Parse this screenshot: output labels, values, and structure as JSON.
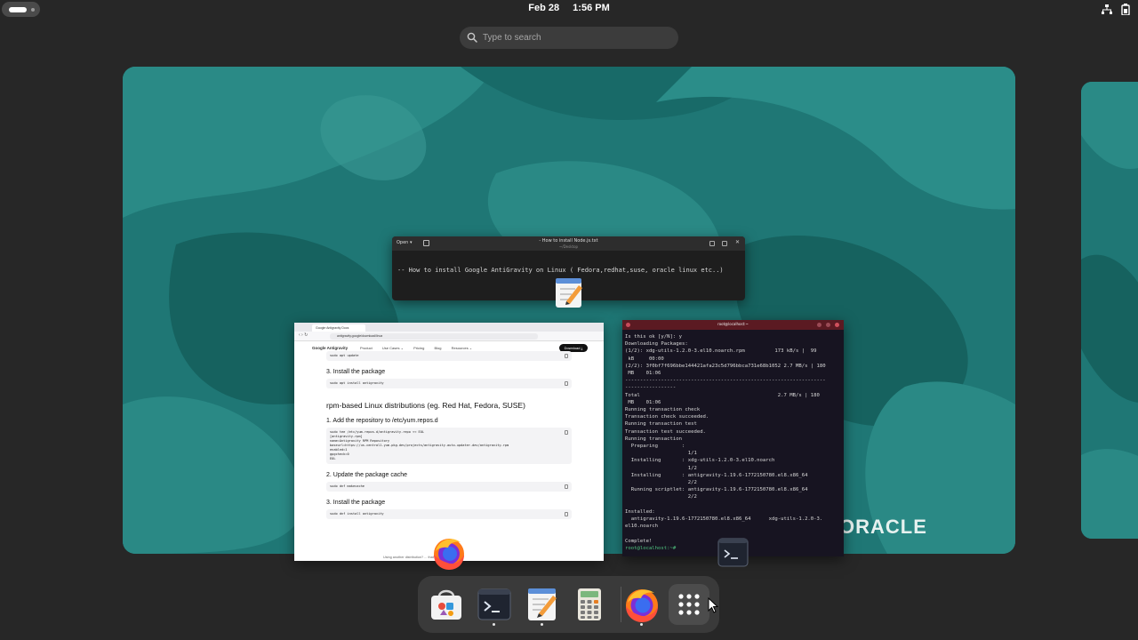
{
  "topbar": {
    "date": "Feb 28",
    "time": "1:56 PM",
    "activities_icon": "activities-indicator",
    "tray_icons": [
      "network-wired-icon",
      "battery-icon"
    ]
  },
  "search": {
    "placeholder": "Type to search"
  },
  "workspace": {
    "wallpaper_brand": "ORACLE"
  },
  "editor_window": {
    "open_label": "Open ▾",
    "title": "- How to install Node.js.txt",
    "subtitle": "~/Desktop",
    "content": "-- How to install Google AntiGravity on Linux ( Fedora,redhat,suse, oracle linux etc..)",
    "app_icon": "text-editor-icon"
  },
  "browser_window": {
    "tab_title": "Google Antigravity Docs",
    "url": "antigravity.google/download/linux",
    "brand": "Google Antigravity",
    "nav_items": [
      "Product",
      "Use Cases ⌄",
      "Pricing",
      "Blog",
      "Resources ⌄"
    ],
    "download_label": "Download ⤓",
    "sections": [
      {
        "kind": "code",
        "text": "sudo apt update"
      },
      {
        "kind": "h3",
        "text": "3. Install the package"
      },
      {
        "kind": "code",
        "text": "sudo apt install antigravity"
      },
      {
        "kind": "h2",
        "text": "rpm-based Linux distributions (eg. Red Hat, Fedora, SUSE)"
      },
      {
        "kind": "h3",
        "text": "1. Add the repository to /etc/yum.repos.d"
      },
      {
        "kind": "code",
        "text": "sudo tee /etc/yum.repos.d/antigravity.repo << EOL\n[antigravity-rpm]\nname=Antigravity RPM Repository\nbaseurl=https://us-central1-yum.pkg.dev/projects/antigravity-auto-updater-dev/antigravity-rpm\nenabled=1\ngpgcheck=0\nEOL"
      },
      {
        "kind": "h3",
        "text": "2. Update the package cache"
      },
      {
        "kind": "code",
        "text": "sudo dnf makecache"
      },
      {
        "kind": "h3",
        "text": "3. Install the package"
      },
      {
        "kind": "code",
        "text": "sudo dnf install antigravity"
      }
    ],
    "footnote": "Using another distribution? ... that source tarball here",
    "app_icon": "firefox-icon"
  },
  "terminal_window": {
    "title": "root@localhost:~",
    "lines": [
      "Is this ok [y/N]: y",
      "Downloading Packages:",
      "(1/2): xdg-utils-1.2.0-3.el10.noarch.rpm          173 kB/s |  99",
      " kB     00:00",
      "(2/2): 3f0bf7f696bbe144421afa23c5d796bbca731e68b1052 2.7 MB/s | 180",
      " MB    01:06",
      "-------------------------------------------------------------------",
      "-----------------",
      "Total                                              2.7 MB/s | 180",
      " MB    01:06",
      "Running transaction check",
      "Transaction check succeeded.",
      "Running transaction test",
      "Transaction test succeeded.",
      "Running transaction",
      "  Preparing        :",
      "                     1/1",
      "  Installing       : xdg-utils-1.2.0-3.el10.noarch",
      "                     1/2",
      "  Installing       : antigravity-1.19.6-1772150780.el8.x86_64",
      "                     2/2",
      "  Running scriptlet: antigravity-1.19.6-1772150780.el8.x86_64",
      "                     2/2",
      "",
      "Installed:",
      "  antigravity-1.19.6-1772150780.el8.x86_64      xdg-utils-1.2.0-3.",
      "el10.noarch",
      "",
      "Complete!"
    ],
    "prompt": "root@localhost:~# ",
    "app_icon": "terminal-icon"
  },
  "dash": {
    "items": [
      {
        "name": "software-center",
        "icon": "software-store-icon",
        "running": false
      },
      {
        "name": "terminal",
        "icon": "terminal-icon",
        "running": true
      },
      {
        "name": "text-editor",
        "icon": "text-editor-icon",
        "running": true
      },
      {
        "name": "calculator",
        "icon": "calculator-icon",
        "running": false
      },
      {
        "name": "firefox",
        "icon": "firefox-icon",
        "running": true
      },
      {
        "name": "show-apps",
        "icon": "app-grid-icon",
        "running": false
      }
    ]
  },
  "colors": {
    "panel_bg": "#272727",
    "wallpaper_teal": "#207c79",
    "terminal_header": "#5b1a22",
    "terminal_bg": "#171421",
    "prompt_green": "#4fc37f"
  }
}
